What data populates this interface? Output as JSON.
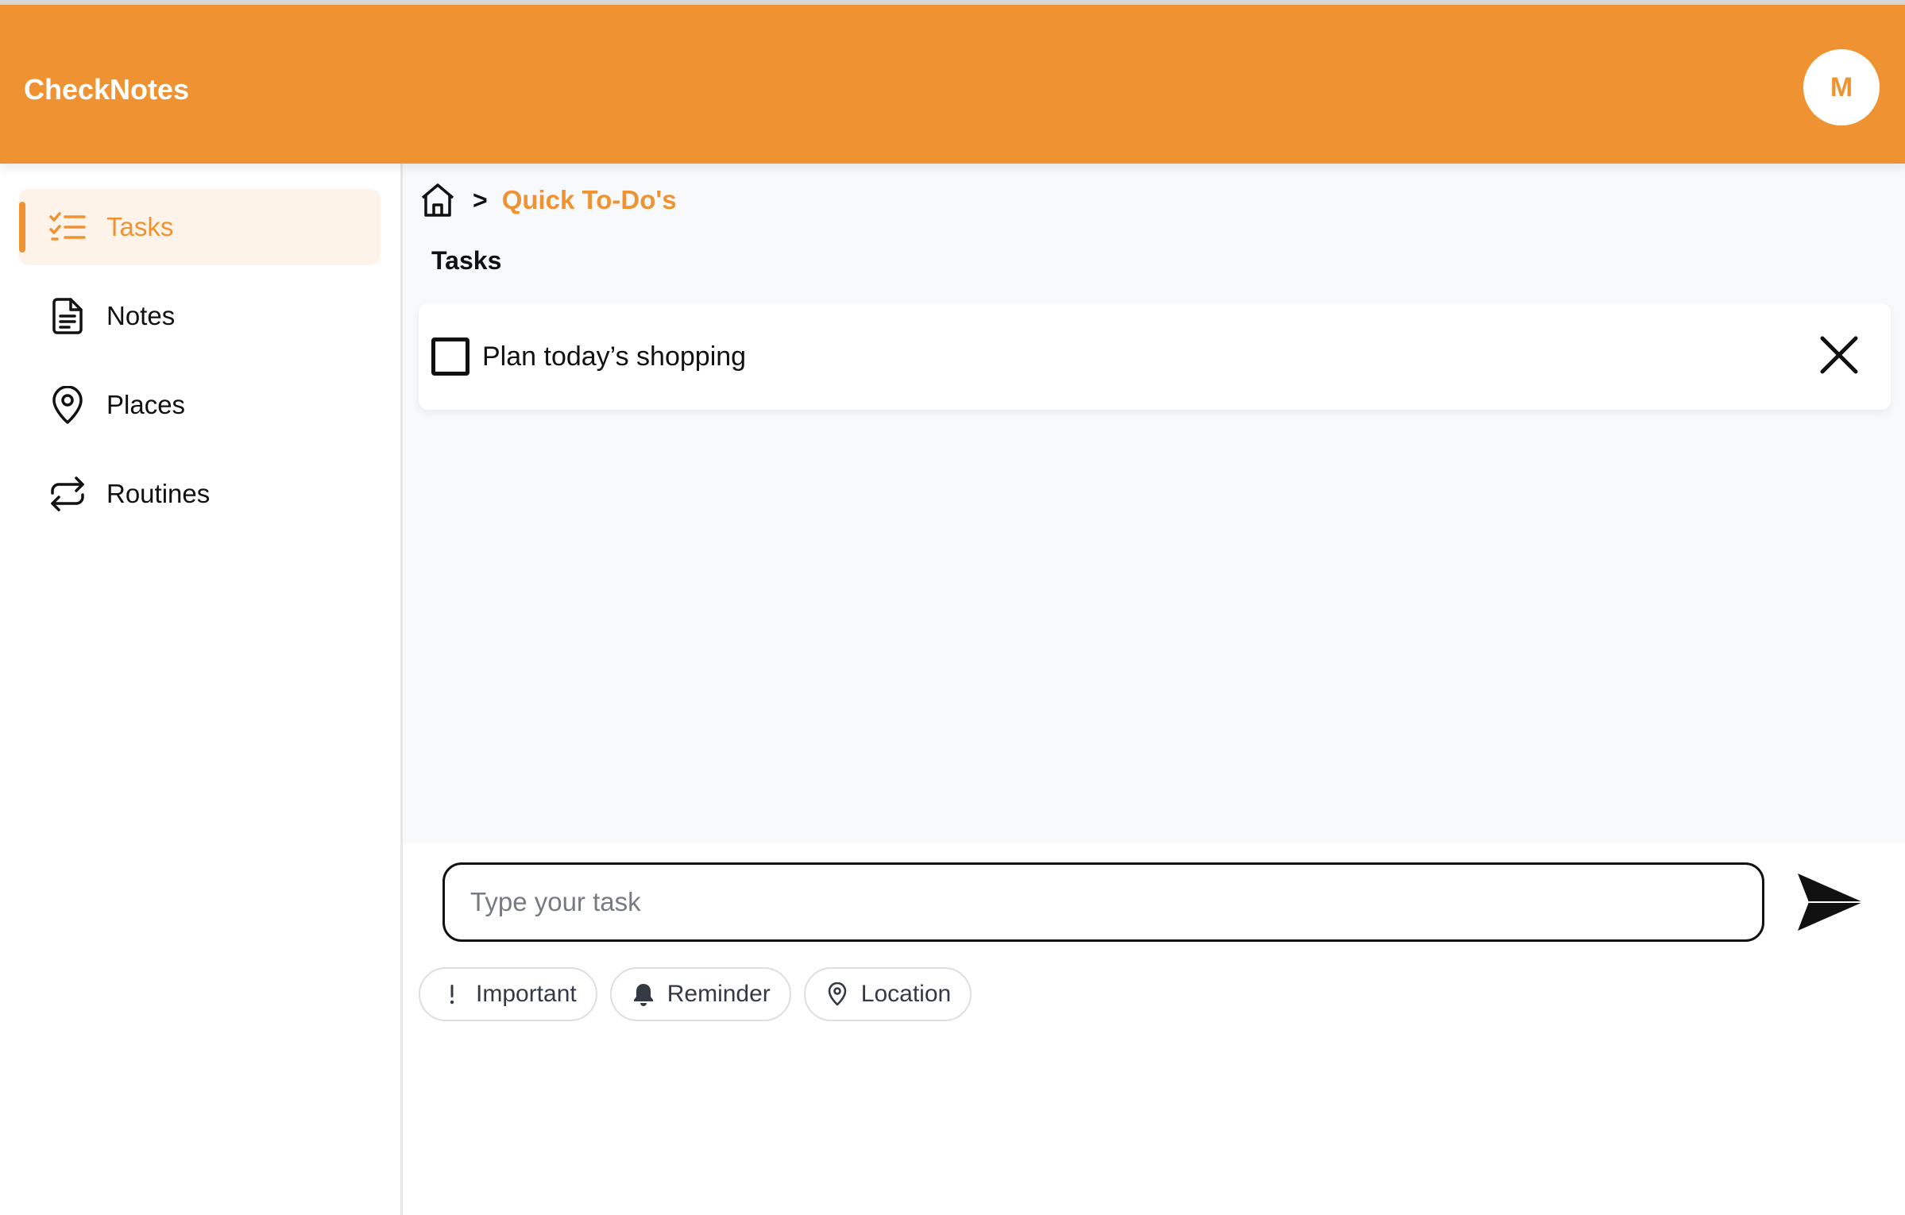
{
  "app": {
    "title": "CheckNotes"
  },
  "user": {
    "initial": "M"
  },
  "sidebar": {
    "items": [
      {
        "label": "Tasks",
        "icon": "task-list-icon",
        "active": true
      },
      {
        "label": "Notes",
        "icon": "document-icon",
        "active": false
      },
      {
        "label": "Places",
        "icon": "map-pin-icon",
        "active": false
      },
      {
        "label": "Routines",
        "icon": "repeat-icon",
        "active": false
      }
    ]
  },
  "breadcrumb": {
    "separator": ">",
    "current": "Quick To-Do's"
  },
  "main": {
    "section_title": "Tasks",
    "tasks": [
      {
        "text": "Plan today’s shopping",
        "done": false
      }
    ]
  },
  "composer": {
    "placeholder": "Type your task",
    "chips": [
      {
        "label": "Important",
        "icon": "exclamation-icon"
      },
      {
        "label": "Reminder",
        "icon": "bell-icon"
      },
      {
        "label": "Location",
        "icon": "map-pin-icon"
      }
    ]
  },
  "colors": {
    "accent": "#ef9332",
    "active_bg": "#fdf3e8",
    "content_bg": "#f8f9fb"
  }
}
